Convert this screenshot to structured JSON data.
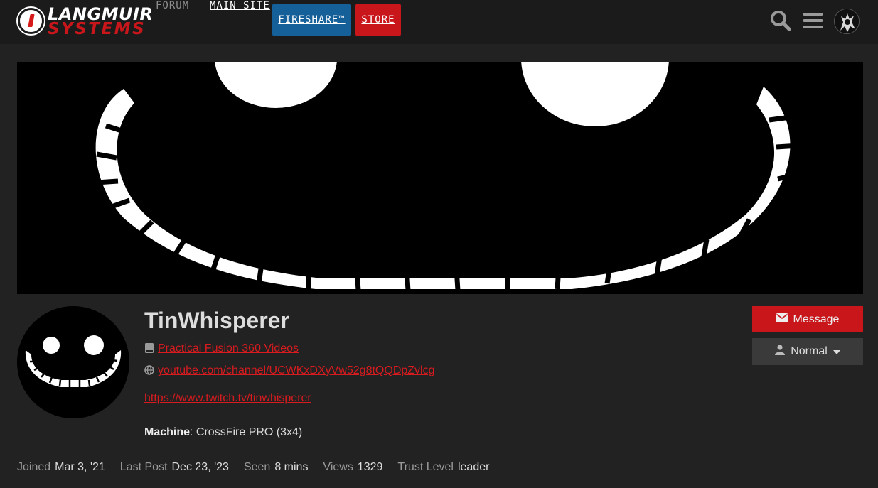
{
  "header": {
    "logo_top": "LANGMUIR",
    "logo_bottom": "SYSTEMS",
    "nav": {
      "forum": "FORUM",
      "main_site": "MAIN SITE",
      "fireshare": "FIRESHARE™",
      "store": "STORE"
    },
    "icons": [
      "search-icon",
      "hamburger-menu-icon",
      "user-avatar"
    ]
  },
  "profile": {
    "username": "TinWhisperer",
    "links": {
      "videos_label": "Practical Fusion 360 Videos",
      "website_label": "youtube.com/channel/UCWKxDXyVw52g8tQQDpZvlcg",
      "twitch_label": "https://www.twitch.tv/tinwhisperer"
    },
    "machine_label": "Machine",
    "machine_value": ": CrossFire PRO (3x4)",
    "buttons": {
      "message": "Message",
      "notification_level": "Normal"
    },
    "stats": {
      "joined_label": "Joined",
      "joined_value": "Mar 3, '21",
      "last_post_label": "Last Post",
      "last_post_value": "Dec 23, '23",
      "seen_label": "Seen",
      "seen_value": "8 mins",
      "views_label": "Views",
      "views_value": "1329",
      "trust_label": "Trust Level",
      "trust_value": "leader"
    }
  },
  "colors": {
    "accent_red": "#c8161b",
    "link_red": "#d81b1f",
    "fireshare_blue": "#16609a",
    "background": "#222222",
    "header_bg": "#1b1b1b"
  }
}
